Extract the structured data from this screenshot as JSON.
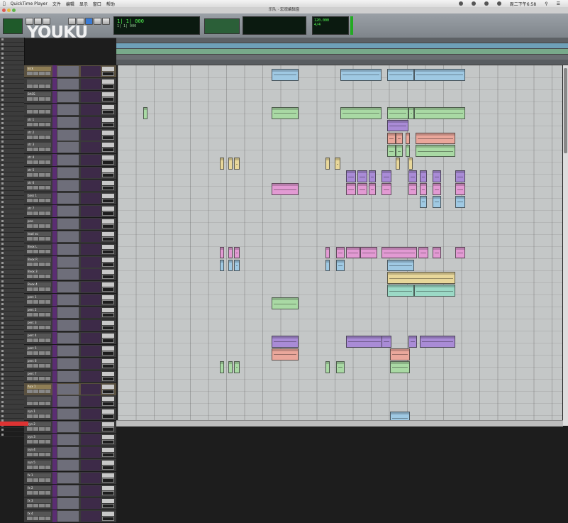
{
  "menubar": {
    "items": [
      "QuickTime Player",
      "文件",
      "编辑",
      "显示",
      "窗口",
      "帮助"
    ],
    "clock": "周二下午6:58"
  },
  "window": {
    "title": "乐队 · 宏观编辑窗"
  },
  "watermark": {
    "text": "YOUKU"
  },
  "transport": {
    "counter_main": "1| 1| 000",
    "counter_alt": "1| 1| 000",
    "tempo": "120.000",
    "meter": "4/4"
  },
  "colors": {
    "clip_blue": "#9fc9e3",
    "clip_green": "#a9d9a4",
    "clip_purple": "#a98bd6",
    "clip_pink": "#e29ad3",
    "clip_salmon": "#eaa79b",
    "clip_yellow": "#e8d79a",
    "clip_teal": "#9bd9c6"
  },
  "tracks": [
    {
      "name": "kick",
      "gold": true
    },
    {
      "name": "",
      "gold": false
    },
    {
      "name": "BASS",
      "gold": false
    },
    {
      "name": "",
      "gold": false
    },
    {
      "name": "str 1",
      "gold": false
    },
    {
      "name": "str 2",
      "gold": false
    },
    {
      "name": "str 3",
      "gold": false
    },
    {
      "name": "str 4",
      "gold": false
    },
    {
      "name": "str 5",
      "gold": false
    },
    {
      "name": "str 6",
      "gold": false
    },
    {
      "name": "bass 1",
      "gold": false
    },
    {
      "name": "str 7",
      "gold": false
    },
    {
      "name": "pno",
      "gold": false
    },
    {
      "name": "lead vo",
      "gold": false
    },
    {
      "name": "Bvox L",
      "gold": false
    },
    {
      "name": "Bvox R",
      "gold": false
    },
    {
      "name": "Bvox 3",
      "gold": false
    },
    {
      "name": "Bvox 4",
      "gold": false
    },
    {
      "name": "perc 1",
      "gold": false
    },
    {
      "name": "perc 2",
      "gold": false
    },
    {
      "name": "perc 3",
      "gold": false
    },
    {
      "name": "perc 4",
      "gold": false
    },
    {
      "name": "perc 5",
      "gold": false
    },
    {
      "name": "perc 6",
      "gold": false
    },
    {
      "name": "perc 7",
      "gold": false
    },
    {
      "name": "Aux 1",
      "gold": true
    },
    {
      "name": "",
      "gold": false
    },
    {
      "name": "syn 1",
      "gold": false
    },
    {
      "name": "syn 2",
      "gold": false
    },
    {
      "name": "syn 3",
      "gold": false
    },
    {
      "name": "syn 4",
      "gold": false
    },
    {
      "name": "syn 5",
      "gold": false
    },
    {
      "name": "fx 1",
      "gold": false
    },
    {
      "name": "fx 2",
      "gold": false
    },
    {
      "name": "fx 3",
      "gold": false
    },
    {
      "name": "fx 4",
      "gold": false
    }
  ]
}
